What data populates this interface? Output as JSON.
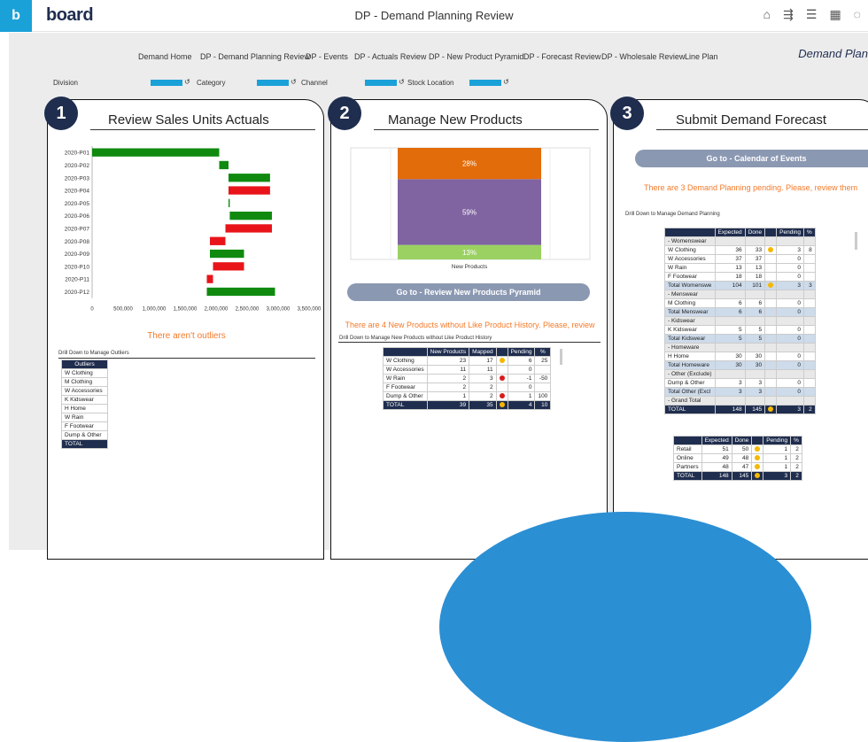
{
  "app": {
    "logo_letter": "b",
    "logo_text": "board",
    "window_title": "DP - Demand Planning Review",
    "page_heading": "Demand Plan"
  },
  "nav": [
    "Demand Home",
    "DP - Demand Planning Review",
    "DP - Events",
    "DP - Actuals Review",
    "DP - New Product Pyramid",
    "DP - Forecast Review",
    "DP - Wholesale Review",
    "Line Plan"
  ],
  "filters": [
    "Division",
    "Category",
    "Channel",
    "Stock Location"
  ],
  "filter_icon": "↺",
  "top_icons": [
    "home-icon",
    "share-icon",
    "list-icon",
    "table-icon",
    "chat-icon"
  ],
  "panel1": {
    "num": "1",
    "title": "Review  Sales Units Actuals",
    "no_outliers": "There aren't outliers",
    "drill_label": "Drill Down to Manage Outliers",
    "outliers_header": "Outliers",
    "outliers": [
      "W Clothing",
      "M Clothing",
      "W Accessories",
      "K Kidswear",
      "H Home",
      "W Rain",
      "F Footwear",
      "Dump & Other",
      "TOTAL"
    ]
  },
  "panel2": {
    "num": "2",
    "title": "Manage New Products",
    "xlabel": "New Products",
    "button": "Go to - Review New Products Pyramid",
    "msg": "There are 4 New Products without Like Product History. Please, review",
    "drill_label": "Drill Down to Manage New Products without Like Product History",
    "table_headers": [
      "",
      "New Products",
      "Mapped",
      "",
      "Pending",
      "%"
    ],
    "table_rows": [
      [
        "W Clothing",
        "23",
        "17",
        "y",
        "6",
        "25"
      ],
      [
        "W Accessories",
        "11",
        "11",
        "",
        "0",
        ""
      ],
      [
        "W Rain",
        "2",
        "3",
        "r",
        "-1",
        "-50"
      ],
      [
        "F Footwear",
        "2",
        "2",
        "",
        "0",
        ""
      ],
      [
        "Dump & Other",
        "1",
        "2",
        "r",
        "1",
        "100"
      ],
      [
        "TOTAL",
        "39",
        "35",
        "y",
        "4",
        "10"
      ]
    ]
  },
  "panel3": {
    "num": "3",
    "title": "Submit Demand Forecast",
    "button": "Go to - Calendar of Events",
    "msg": "There are 3 Demand Planning pending. Please, review them",
    "drill_label": "Drill Down to Manage Demand Planning",
    "t1_headers": [
      "",
      "Expected",
      "Done",
      "",
      "Pending",
      "%"
    ],
    "t1_rows": [
      [
        "g",
        "- Womenswear",
        "",
        "",
        "",
        "",
        ""
      ],
      [
        "",
        "W Clothing",
        "36",
        "33",
        "y",
        "3",
        "8"
      ],
      [
        "",
        "W Accessories",
        "37",
        "37",
        "",
        "0",
        ""
      ],
      [
        "",
        "W Rain",
        "13",
        "13",
        "",
        "0",
        ""
      ],
      [
        "",
        "F Footwear",
        "18",
        "18",
        "",
        "0",
        ""
      ],
      [
        "s",
        "Total Womenswe",
        "104",
        "101",
        "y",
        "3",
        "3"
      ],
      [
        "g",
        "- Menswear",
        "",
        "",
        "",
        "",
        ""
      ],
      [
        "",
        "M Clothing",
        "6",
        "6",
        "",
        "0",
        ""
      ],
      [
        "s",
        "Total Menswear",
        "6",
        "6",
        "",
        "0",
        ""
      ],
      [
        "g",
        "- Kidswear",
        "",
        "",
        "",
        "",
        ""
      ],
      [
        "",
        "K Kidswear",
        "5",
        "5",
        "",
        "0",
        ""
      ],
      [
        "s",
        "Total Kidswear",
        "5",
        "5",
        "",
        "0",
        ""
      ],
      [
        "g",
        "- Homeware",
        "",
        "",
        "",
        "",
        ""
      ],
      [
        "",
        "H Home",
        "30",
        "30",
        "",
        "0",
        ""
      ],
      [
        "s",
        "Total Homeware",
        "30",
        "30",
        "",
        "0",
        ""
      ],
      [
        "g",
        "- Other (Exclude)",
        "",
        "",
        "",
        "",
        ""
      ],
      [
        "",
        "Dump & Other",
        "3",
        "3",
        "",
        "0",
        ""
      ],
      [
        "s",
        "Total Other (Excl",
        "3",
        "3",
        "",
        "0",
        ""
      ],
      [
        "g",
        "- Grand Total",
        "",
        "",
        "",
        "",
        ""
      ],
      [
        "t",
        "TOTAL",
        "148",
        "145",
        "y",
        "3",
        "2"
      ]
    ],
    "t2_headers": [
      "",
      "Expected",
      "Done",
      "",
      "Pending",
      "%"
    ],
    "t2_rows": [
      [
        "Retail",
        "51",
        "50",
        "y",
        "1",
        "2"
      ],
      [
        "Online",
        "49",
        "48",
        "y",
        "1",
        "2"
      ],
      [
        "Partners",
        "48",
        "47",
        "y",
        "1",
        "2"
      ],
      [
        "TOTAL",
        "148",
        "145",
        "y",
        "3",
        "2"
      ]
    ]
  },
  "colors": {
    "green": "#0f8a0f",
    "red": "#e8141a",
    "orange": "#e36c0a",
    "purple": "#8064a2",
    "lightgreen": "#9bd162",
    "navy": "#1f2d4e",
    "accent": "#1aa1d8"
  },
  "chart_data": [
    {
      "type": "bar",
      "orientation": "horizontal-waterfall",
      "categories": [
        "2020-P01",
        "2020-P02",
        "2020-P03",
        "2020-P04",
        "2020-P05",
        "2020-P06",
        "2020-P07",
        "2020-P08",
        "2020-P09",
        "2020-P10",
        "2020-P11",
        "2020-P12"
      ],
      "ranges": [
        [
          0,
          2050000
        ],
        [
          2050000,
          2200000
        ],
        [
          2200000,
          2870000
        ],
        [
          2870000,
          2200000
        ],
        [
          2200000,
          2220000
        ],
        [
          2220000,
          2900000
        ],
        [
          2900000,
          2150000
        ],
        [
          2150000,
          1900000
        ],
        [
          1900000,
          2450000
        ],
        [
          2450000,
          1950000
        ],
        [
          1950000,
          1850000
        ],
        [
          1850000,
          2950000
        ]
      ],
      "xticks": [
        0,
        500000,
        1000000,
        1500000,
        2000000,
        2500000,
        3000000,
        3500000
      ],
      "xtick_labels": [
        "0",
        "500,000",
        "1,000,000",
        "1,500,000",
        "2,000,000",
        "2,500,000",
        "3,000,000",
        "3,500,000"
      ],
      "xlim": [
        0,
        3500000
      ]
    },
    {
      "type": "bar",
      "orientation": "stacked-100",
      "categories": [
        "New Products"
      ],
      "series": [
        {
          "name": "",
          "value": 13,
          "label": "13%"
        },
        {
          "name": "",
          "value": 59,
          "label": "59%"
        },
        {
          "name": "",
          "value": 28,
          "label": "28%"
        }
      ]
    }
  ]
}
